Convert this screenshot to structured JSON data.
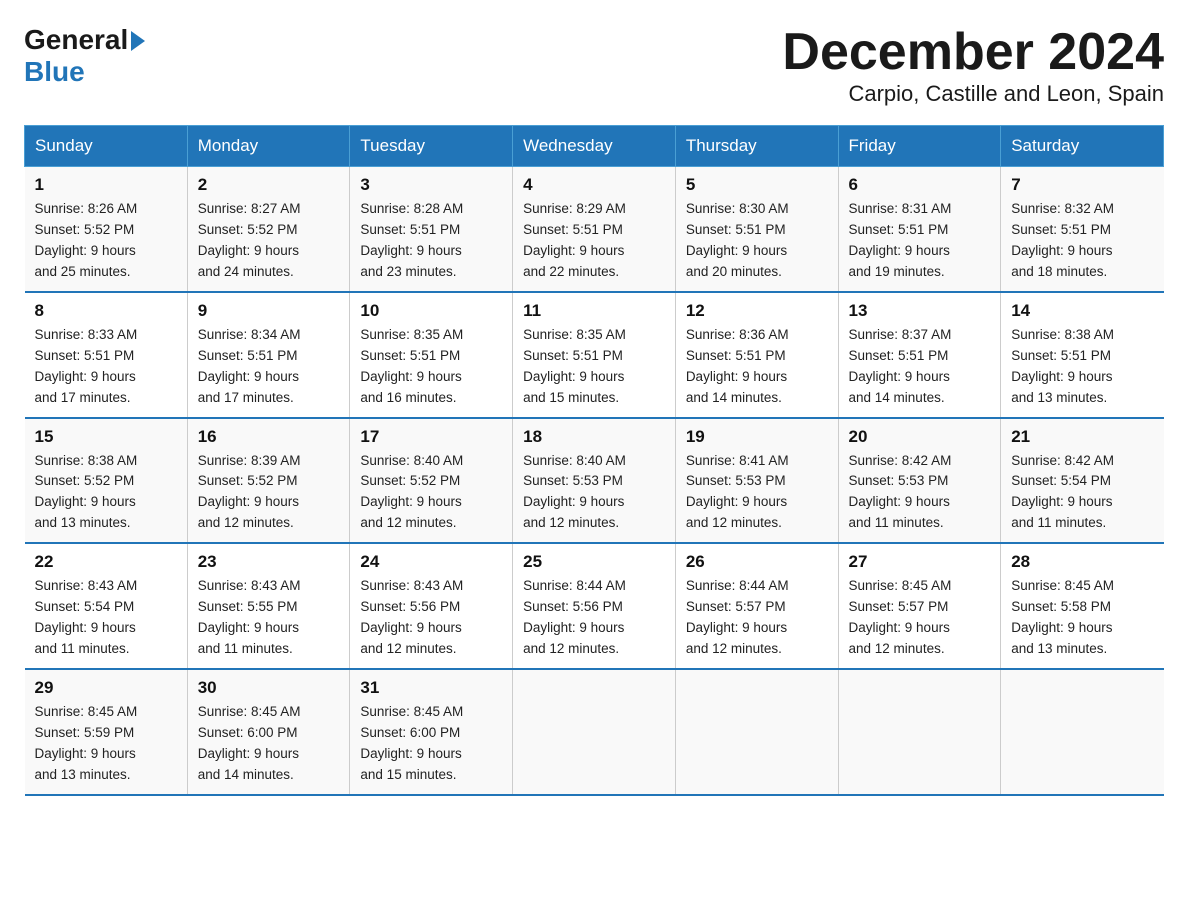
{
  "header": {
    "logo_general": "General",
    "logo_blue": "Blue",
    "title": "December 2024",
    "subtitle": "Carpio, Castille and Leon, Spain"
  },
  "weekdays": [
    "Sunday",
    "Monday",
    "Tuesday",
    "Wednesday",
    "Thursday",
    "Friday",
    "Saturday"
  ],
  "weeks": [
    [
      {
        "num": "1",
        "sunrise": "8:26 AM",
        "sunset": "5:52 PM",
        "daylight": "9 hours and 25 minutes."
      },
      {
        "num": "2",
        "sunrise": "8:27 AM",
        "sunset": "5:52 PM",
        "daylight": "9 hours and 24 minutes."
      },
      {
        "num": "3",
        "sunrise": "8:28 AM",
        "sunset": "5:51 PM",
        "daylight": "9 hours and 23 minutes."
      },
      {
        "num": "4",
        "sunrise": "8:29 AM",
        "sunset": "5:51 PM",
        "daylight": "9 hours and 22 minutes."
      },
      {
        "num": "5",
        "sunrise": "8:30 AM",
        "sunset": "5:51 PM",
        "daylight": "9 hours and 20 minutes."
      },
      {
        "num": "6",
        "sunrise": "8:31 AM",
        "sunset": "5:51 PM",
        "daylight": "9 hours and 19 minutes."
      },
      {
        "num": "7",
        "sunrise": "8:32 AM",
        "sunset": "5:51 PM",
        "daylight": "9 hours and 18 minutes."
      }
    ],
    [
      {
        "num": "8",
        "sunrise": "8:33 AM",
        "sunset": "5:51 PM",
        "daylight": "9 hours and 17 minutes."
      },
      {
        "num": "9",
        "sunrise": "8:34 AM",
        "sunset": "5:51 PM",
        "daylight": "9 hours and 17 minutes."
      },
      {
        "num": "10",
        "sunrise": "8:35 AM",
        "sunset": "5:51 PM",
        "daylight": "9 hours and 16 minutes."
      },
      {
        "num": "11",
        "sunrise": "8:35 AM",
        "sunset": "5:51 PM",
        "daylight": "9 hours and 15 minutes."
      },
      {
        "num": "12",
        "sunrise": "8:36 AM",
        "sunset": "5:51 PM",
        "daylight": "9 hours and 14 minutes."
      },
      {
        "num": "13",
        "sunrise": "8:37 AM",
        "sunset": "5:51 PM",
        "daylight": "9 hours and 14 minutes."
      },
      {
        "num": "14",
        "sunrise": "8:38 AM",
        "sunset": "5:51 PM",
        "daylight": "9 hours and 13 minutes."
      }
    ],
    [
      {
        "num": "15",
        "sunrise": "8:38 AM",
        "sunset": "5:52 PM",
        "daylight": "9 hours and 13 minutes."
      },
      {
        "num": "16",
        "sunrise": "8:39 AM",
        "sunset": "5:52 PM",
        "daylight": "9 hours and 12 minutes."
      },
      {
        "num": "17",
        "sunrise": "8:40 AM",
        "sunset": "5:52 PM",
        "daylight": "9 hours and 12 minutes."
      },
      {
        "num": "18",
        "sunrise": "8:40 AM",
        "sunset": "5:53 PM",
        "daylight": "9 hours and 12 minutes."
      },
      {
        "num": "19",
        "sunrise": "8:41 AM",
        "sunset": "5:53 PM",
        "daylight": "9 hours and 12 minutes."
      },
      {
        "num": "20",
        "sunrise": "8:42 AM",
        "sunset": "5:53 PM",
        "daylight": "9 hours and 11 minutes."
      },
      {
        "num": "21",
        "sunrise": "8:42 AM",
        "sunset": "5:54 PM",
        "daylight": "9 hours and 11 minutes."
      }
    ],
    [
      {
        "num": "22",
        "sunrise": "8:43 AM",
        "sunset": "5:54 PM",
        "daylight": "9 hours and 11 minutes."
      },
      {
        "num": "23",
        "sunrise": "8:43 AM",
        "sunset": "5:55 PM",
        "daylight": "9 hours and 11 minutes."
      },
      {
        "num": "24",
        "sunrise": "8:43 AM",
        "sunset": "5:56 PM",
        "daylight": "9 hours and 12 minutes."
      },
      {
        "num": "25",
        "sunrise": "8:44 AM",
        "sunset": "5:56 PM",
        "daylight": "9 hours and 12 minutes."
      },
      {
        "num": "26",
        "sunrise": "8:44 AM",
        "sunset": "5:57 PM",
        "daylight": "9 hours and 12 minutes."
      },
      {
        "num": "27",
        "sunrise": "8:45 AM",
        "sunset": "5:57 PM",
        "daylight": "9 hours and 12 minutes."
      },
      {
        "num": "28",
        "sunrise": "8:45 AM",
        "sunset": "5:58 PM",
        "daylight": "9 hours and 13 minutes."
      }
    ],
    [
      {
        "num": "29",
        "sunrise": "8:45 AM",
        "sunset": "5:59 PM",
        "daylight": "9 hours and 13 minutes."
      },
      {
        "num": "30",
        "sunrise": "8:45 AM",
        "sunset": "6:00 PM",
        "daylight": "9 hours and 14 minutes."
      },
      {
        "num": "31",
        "sunrise": "8:45 AM",
        "sunset": "6:00 PM",
        "daylight": "9 hours and 15 minutes."
      },
      null,
      null,
      null,
      null
    ]
  ],
  "labels": {
    "sunrise": "Sunrise:",
    "sunset": "Sunset:",
    "daylight": "Daylight:"
  }
}
